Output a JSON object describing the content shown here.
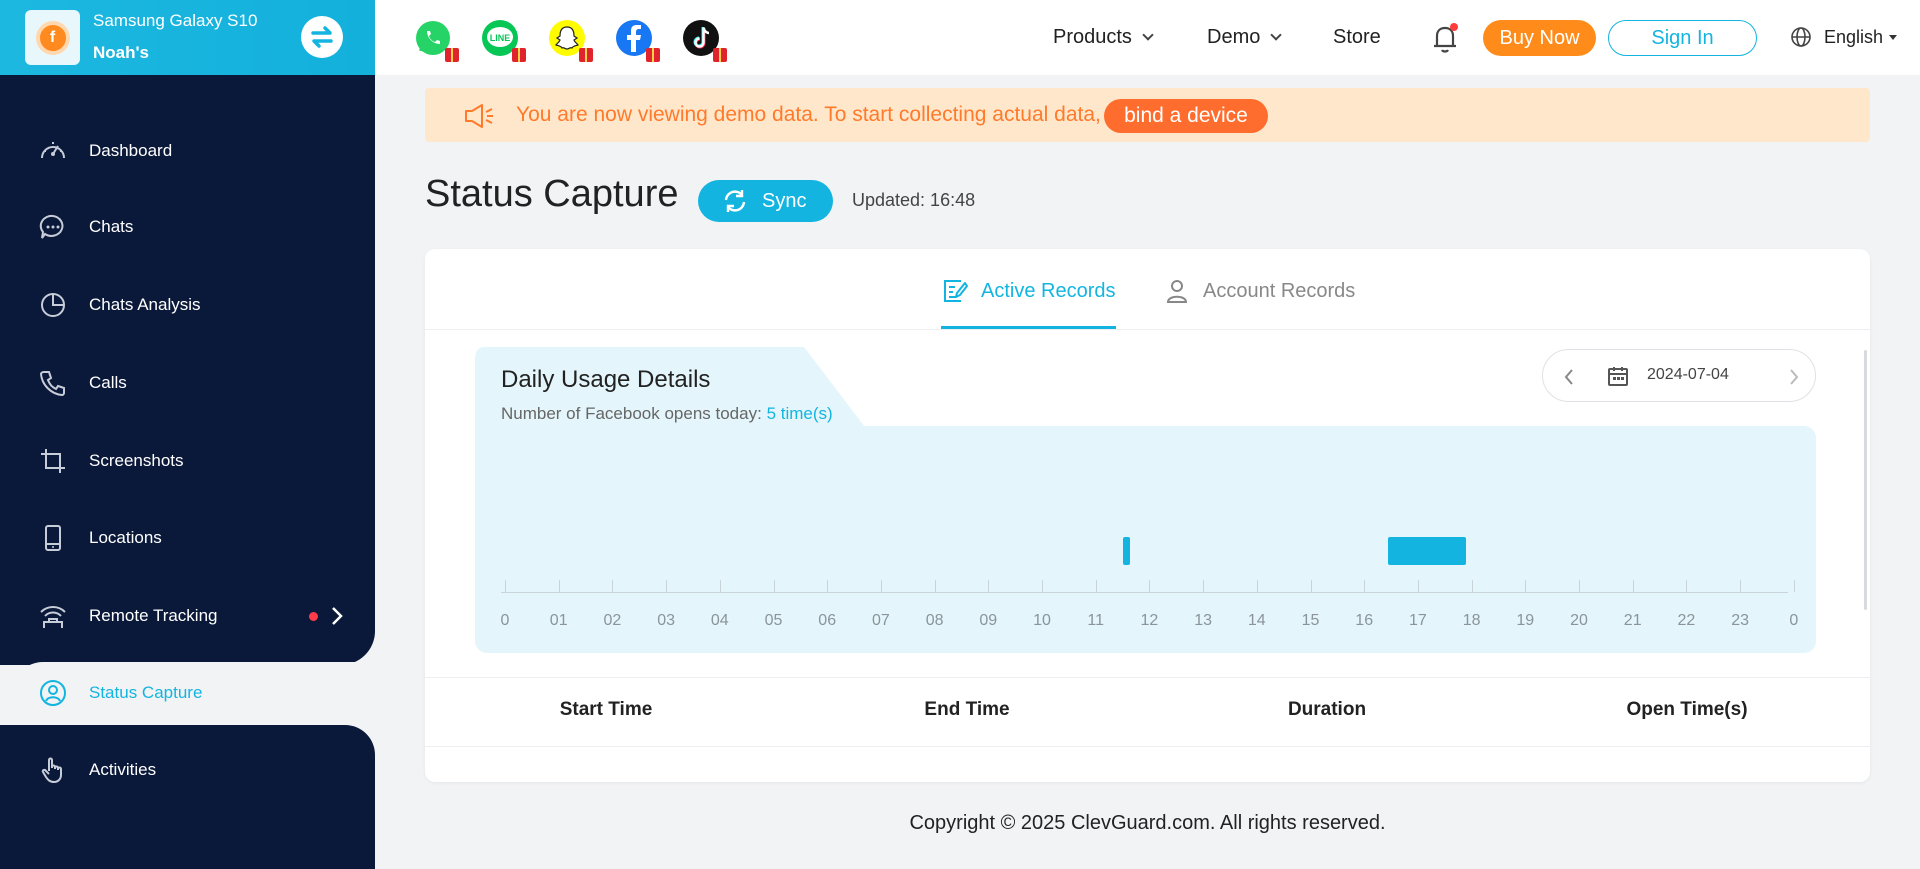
{
  "device": {
    "name": "Samsung Galaxy S10",
    "owner": "Noah's"
  },
  "sidebar": {
    "items": [
      {
        "key": "dashboard",
        "label": "Dashboard",
        "icon": "gauge-icon"
      },
      {
        "key": "chats",
        "label": "Chats",
        "icon": "chat-bubble-icon"
      },
      {
        "key": "chats-analysis",
        "label": "Chats Analysis",
        "icon": "pie-chart-icon"
      },
      {
        "key": "calls",
        "label": "Calls",
        "icon": "phone-icon"
      },
      {
        "key": "screenshots",
        "label": "Screenshots",
        "icon": "crop-icon"
      },
      {
        "key": "locations",
        "label": "Locations",
        "icon": "mobile-device-icon"
      },
      {
        "key": "remote-tracking",
        "label": "Remote Tracking",
        "icon": "wifi-signal-icon"
      },
      {
        "key": "status-capture",
        "label": "Status Capture",
        "icon": "user-circle-icon",
        "active": true
      },
      {
        "key": "activities",
        "label": "Activities",
        "icon": "hand-pointer-icon"
      }
    ]
  },
  "topbar": {
    "apps": [
      "whatsapp",
      "line",
      "snapchat",
      "facebook",
      "tiktok"
    ],
    "menu": {
      "products": "Products",
      "demo": "Demo",
      "store": "Store"
    },
    "buy_label": "Buy Now",
    "signin_label": "Sign In",
    "language": "English"
  },
  "notice": {
    "text": "You are now viewing demo data. To start collecting actual data,",
    "button": "bind a device"
  },
  "page": {
    "title": "Status Capture",
    "sync_label": "Sync",
    "updated": "Updated: 16:48"
  },
  "tabs": {
    "active": "Active Records",
    "account": "Account Records"
  },
  "usage": {
    "title": "Daily Usage Details",
    "subtitle_prefix": "Number of Facebook opens today:",
    "count": "5 time(s)",
    "date": "2024-07-04",
    "hours": [
      "0",
      "01",
      "02",
      "03",
      "04",
      "05",
      "06",
      "07",
      "08",
      "09",
      "10",
      "11",
      "12",
      "13",
      "14",
      "15",
      "16",
      "17",
      "18",
      "19",
      "20",
      "21",
      "22",
      "23",
      "0"
    ],
    "sessions": [
      {
        "start_hour": 11.5,
        "end_hour": 11.62
      },
      {
        "start_hour": 16.45,
        "end_hour": 17.9
      }
    ]
  },
  "table": {
    "headers": [
      "Start Time",
      "End Time",
      "Duration",
      "Open Time(s)"
    ]
  },
  "footer": {
    "copyright": "Copyright © 2025 ClevGuard.com. All rights reserved."
  },
  "colors": {
    "accent": "#13b5e0",
    "sidebar": "#0a1839",
    "orange": "#ff8c1a",
    "notice_bg": "#ffe7cc"
  }
}
